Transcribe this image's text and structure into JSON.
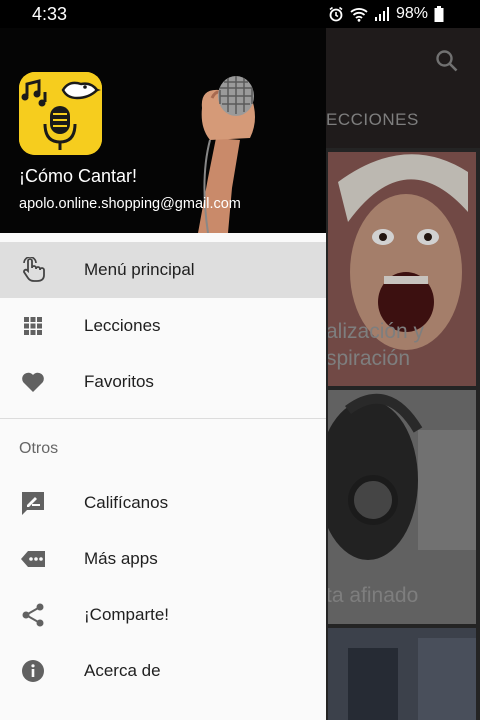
{
  "status": {
    "time": "4:33",
    "battery": "98%"
  },
  "background": {
    "tab_partial": "ECCIONES",
    "cards": [
      {
        "caption_line1": "alización y",
        "caption_line2": "spiración"
      },
      {
        "caption_line1": "ta afinado",
        "caption_line2": ""
      }
    ]
  },
  "drawer": {
    "header": {
      "title": "¡Cómo Cantar!",
      "email": "apolo.online.shopping@gmail.com"
    },
    "items": [
      {
        "label": "Menú principal",
        "icon": "hand-pointer-icon",
        "active": true
      },
      {
        "label": "Lecciones",
        "icon": "grid-icon",
        "active": false
      },
      {
        "label": "Favoritos",
        "icon": "heart-icon",
        "active": false
      }
    ],
    "section_label": "Otros",
    "other_items": [
      {
        "label": "Califícanos",
        "icon": "rate-review-icon"
      },
      {
        "label": "Más apps",
        "icon": "more-apps-icon"
      },
      {
        "label": "¡Comparte!",
        "icon": "share-icon"
      },
      {
        "label": "Acerca de",
        "icon": "info-icon"
      }
    ]
  },
  "colors": {
    "logo_yellow": "#f6cd1e",
    "active_bg": "#dedede",
    "icon_grey": "#616161"
  }
}
